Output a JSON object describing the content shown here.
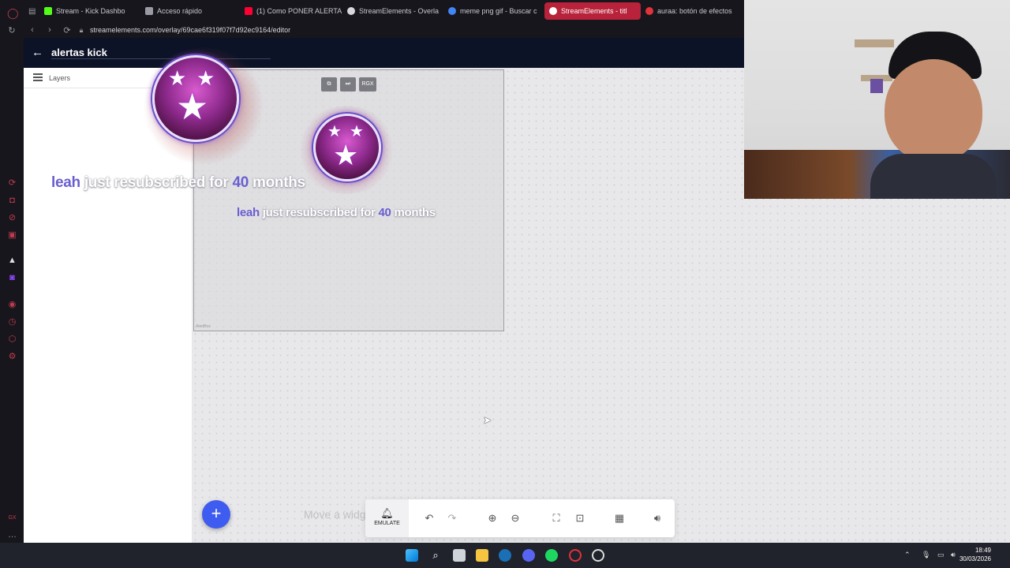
{
  "browser": {
    "tabs": [
      {
        "label": "Stream - Kick Dashbo",
        "favicon_color": "#53fc18"
      },
      {
        "label": "Acceso rápido",
        "favicon_color": "#9a9aa5"
      },
      {
        "label": "(1) Como PONER ALERTA",
        "favicon_color": "#ff0033"
      },
      {
        "label": "StreamElements - Overla",
        "favicon_color": "#d7d7de"
      },
      {
        "label": "meme png gif - Buscar c",
        "favicon_color": "#4285f4"
      },
      {
        "label": "StreamElements - titl",
        "favicon_color": "#ffffff"
      },
      {
        "label": "auraa: botón de efectos d",
        "favicon_color": "#e2323a"
      }
    ],
    "active_tab_index": 5,
    "url": "streamelements.com/overlay/69cae6f319f07f7d92ec9164/editor",
    "accent_color": "#b8223a"
  },
  "editor": {
    "title": "alertas kick",
    "layers_label": "Layers",
    "frame_corner_text": "AlertBox",
    "widget_tools": [
      "⧉",
      "⏭",
      "RGX"
    ],
    "alert_preview": {
      "name": "leah",
      "middle": "just resubscribed for",
      "months": "40",
      "suffix": "months"
    },
    "add_button_label": "+",
    "hint_text": "Move a widget",
    "toolbar": {
      "emulate_label": "EMULATE",
      "icons": [
        "undo-icon",
        "redo-icon",
        "zoom-in-icon",
        "zoom-out-icon",
        "fullscreen-icon",
        "exit-fullscreen-icon",
        "grid-icon",
        "volume-icon"
      ]
    }
  },
  "taskbar": {
    "time": "18:49",
    "date": "30/03/2026",
    "pinned": [
      "windows-start-icon",
      "search-icon",
      "task-view-icon",
      "file-explorer-icon",
      "steam-icon",
      "discord-icon",
      "spotify-icon",
      "opera-gx-icon",
      "obs-icon"
    ]
  }
}
